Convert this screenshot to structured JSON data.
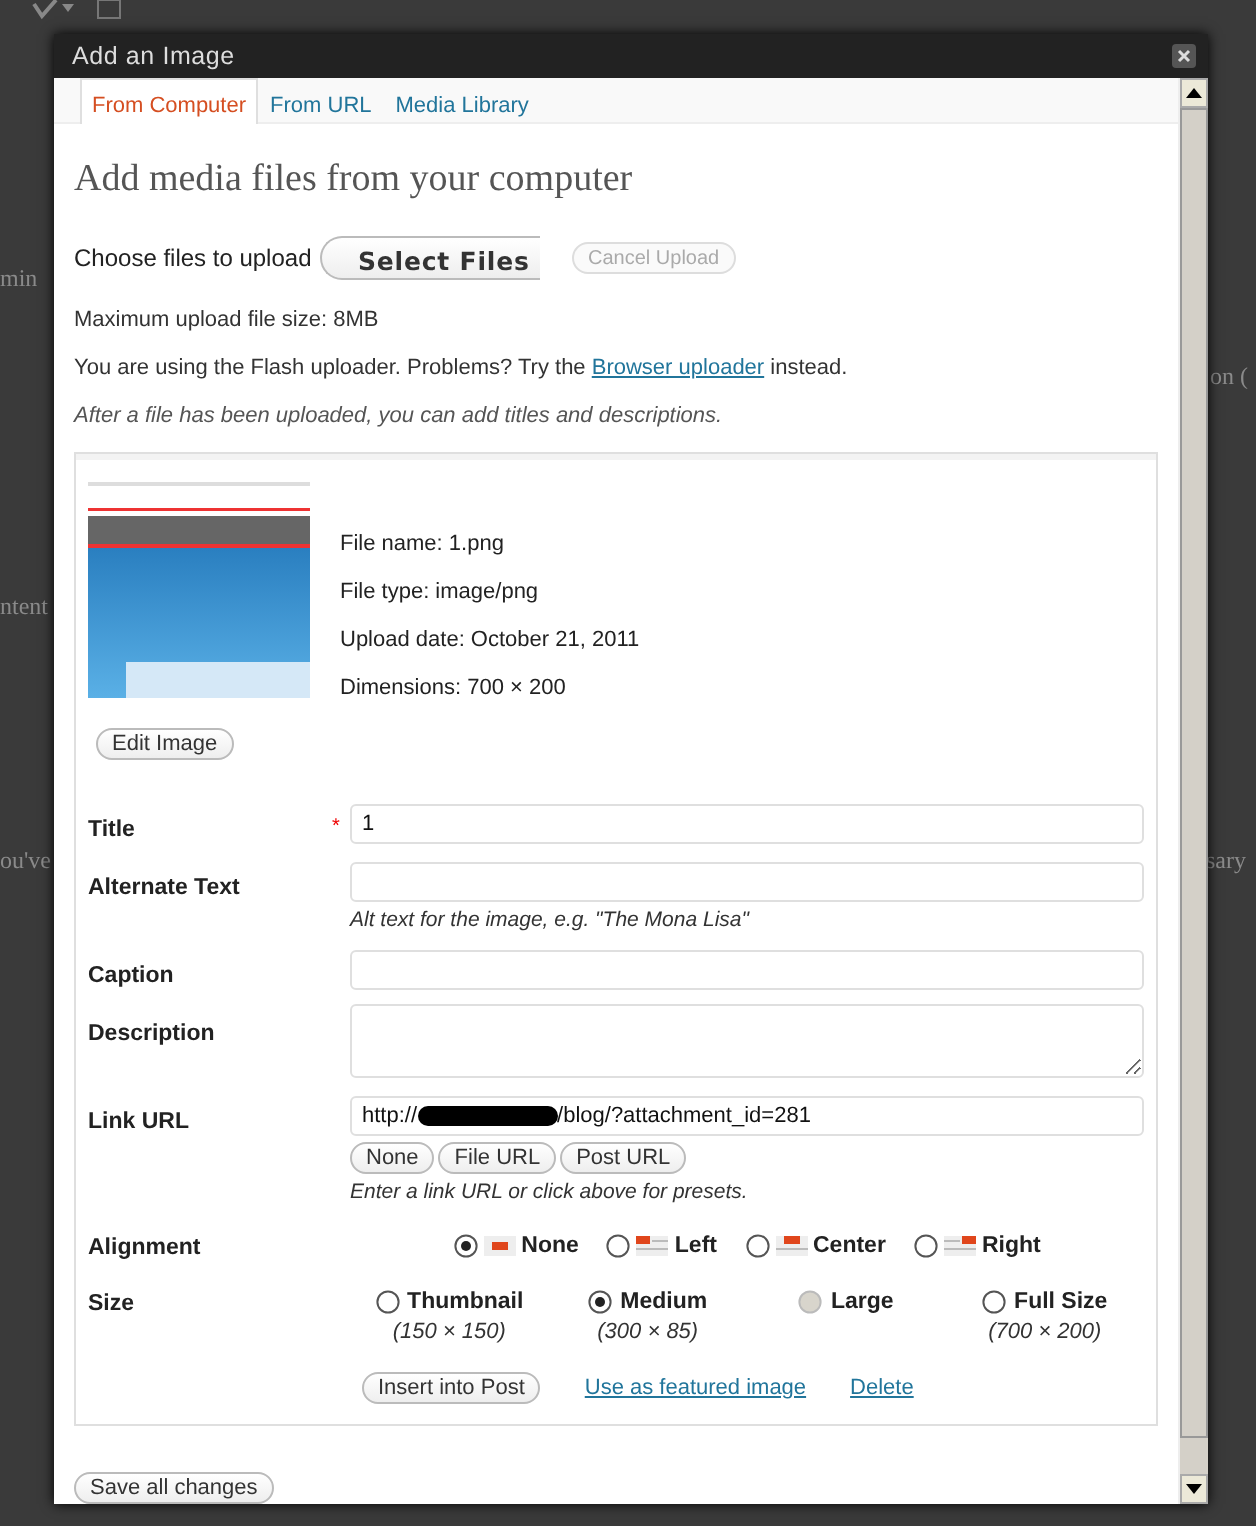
{
  "background_fragments": [
    "min",
    "on (",
    "ntent",
    "ou've",
    "sary"
  ],
  "dialog": {
    "title": "Add an Image"
  },
  "tabs": [
    {
      "label": "From Computer",
      "selected": true
    },
    {
      "label": "From URL",
      "selected": false
    },
    {
      "label": "Media Library",
      "selected": false
    }
  ],
  "heading": "Add media files from your computer",
  "upload": {
    "label": "Choose files to upload",
    "select_button": "Select Files",
    "cancel_button": "Cancel Upload",
    "cancel_disabled": true
  },
  "max_size": "Maximum upload file size: 8MB",
  "flash_notice": {
    "text_before": "You are using the Flash uploader. Problems? Try the",
    "link": "Browser uploader",
    "text_after": "instead."
  },
  "after_upload_note": "After a file has been uploaded, you can add titles and descriptions.",
  "file": {
    "details": [
      "File name: 1.png",
      "File type: image/png",
      "Upload date: October 21, 2011",
      "Dimensions: 700 × 200"
    ],
    "edit_button": "Edit Image"
  },
  "fields": [
    {
      "kind": "text",
      "label": "Title",
      "required_mark": "*",
      "value": "1"
    },
    {
      "kind": "text",
      "label": "Alternate Text",
      "hint": "Alt text for the image, e.g. \"The Mona Lisa\""
    },
    {
      "kind": "text",
      "label": "Caption"
    },
    {
      "kind": "textarea",
      "label": "Description"
    },
    {
      "kind": "url",
      "label": "Link URL",
      "value_prefix": "http://",
      "redacted": true,
      "value_suffix": "/blog/?attachment_id=281",
      "buttons": [
        "None",
        "File URL",
        "Post URL"
      ],
      "hint": "Enter a link URL or click above for presets."
    },
    {
      "kind": "align",
      "label": "Alignment",
      "options": [
        {
          "kind": "none",
          "label": "None",
          "selected": true
        },
        {
          "kind": "left",
          "label": "Left",
          "selected": false
        },
        {
          "kind": "center",
          "label": "Center",
          "selected": false
        },
        {
          "kind": "right",
          "label": "Right",
          "selected": false
        }
      ]
    },
    {
      "kind": "size",
      "label": "Size",
      "options": [
        {
          "label": "Thumbnail",
          "dims": "(150 × 150)",
          "selected": false,
          "disabled": false
        },
        {
          "label": "Medium",
          "dims": "(300 × 85)",
          "selected": true,
          "disabled": false
        },
        {
          "label": "Large",
          "selected": false,
          "disabled": true
        },
        {
          "label": "Full Size",
          "dims": "(700 × 200)",
          "selected": false,
          "disabled": false
        }
      ]
    }
  ],
  "actions": {
    "insert_button": "Insert into Post",
    "featured_link": "Use as featured image",
    "delete_link": "Delete"
  },
  "save_button": "Save all changes"
}
